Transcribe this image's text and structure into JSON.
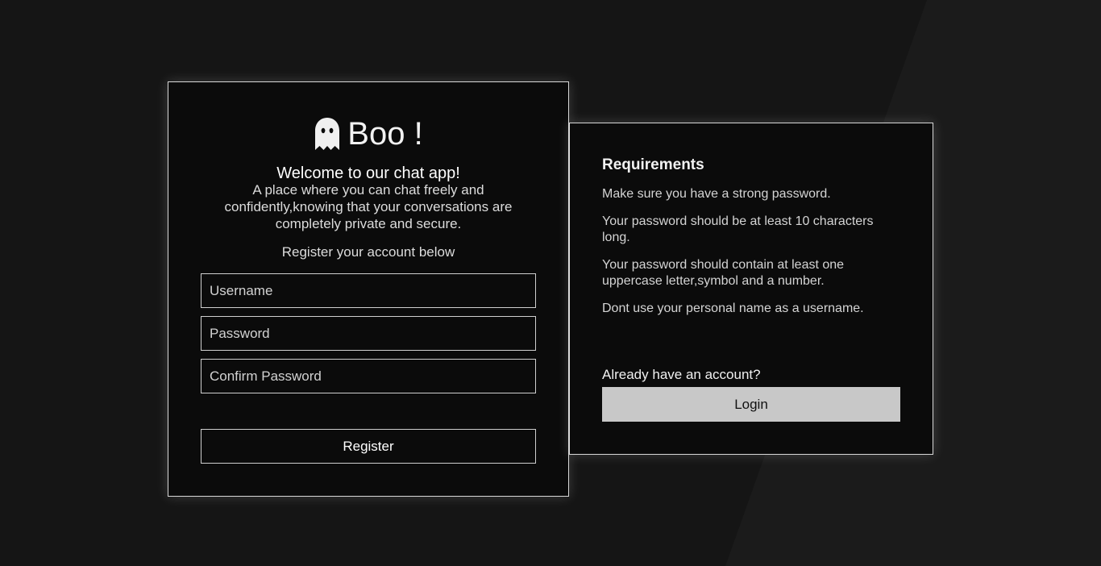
{
  "brand": {
    "name": "Boo !",
    "icon": "ghost-icon"
  },
  "register": {
    "welcome": "Welcome to our chat app!",
    "tagline": "A place where you can chat freely and confidently,knowing that your conversations are completely private and secure.",
    "prompt": "Register your account below",
    "fields": {
      "username": {
        "placeholder": "Username",
        "value": ""
      },
      "password": {
        "placeholder": "Password",
        "value": ""
      },
      "confirm_password": {
        "placeholder": "Confirm Password",
        "value": ""
      }
    },
    "submit_label": "Register"
  },
  "requirements": {
    "title": "Requirements",
    "items": [
      "Make sure you have a strong password.",
      "Your password should be at least 10 characters long.",
      "Your password should contain at least one uppercase letter,symbol and a number.",
      "Dont use your personal name as a username."
    ]
  },
  "login": {
    "prompt": "Already have an account?",
    "button_label": "Login"
  },
  "colors": {
    "background": "#151515",
    "card": "#0b0b0b",
    "border": "#d8d8d8",
    "login_button": "#c8c8c8"
  }
}
